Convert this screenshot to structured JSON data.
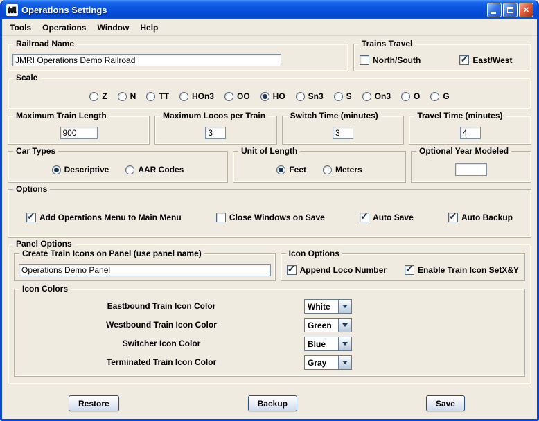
{
  "window": {
    "title": "Operations Settings",
    "controls": {
      "minimize": "minimize",
      "maximize": "maximize",
      "close": "close"
    }
  },
  "colors": {
    "titlebar_blue": "#0a55e0",
    "panel_bg": "#f0ebe0",
    "close_red": "#c23a1a"
  },
  "menu": {
    "items": [
      "Tools",
      "Operations",
      "Window",
      "Help"
    ]
  },
  "railroad": {
    "title": "Railroad Name",
    "value": "JMRI Operations Demo Railroad"
  },
  "trains_travel": {
    "title": "Trains Travel",
    "options": [
      {
        "label": "North/South",
        "checked": false
      },
      {
        "label": "East/West",
        "checked": true
      }
    ]
  },
  "scale": {
    "title": "Scale",
    "options": [
      {
        "label": "Z",
        "selected": false
      },
      {
        "label": "N",
        "selected": false
      },
      {
        "label": "TT",
        "selected": false
      },
      {
        "label": "HOn3",
        "selected": false
      },
      {
        "label": "OO",
        "selected": false
      },
      {
        "label": "HO",
        "selected": true
      },
      {
        "label": "Sn3",
        "selected": false
      },
      {
        "label": "S",
        "selected": false
      },
      {
        "label": "On3",
        "selected": false
      },
      {
        "label": "O",
        "selected": false
      },
      {
        "label": "G",
        "selected": false
      }
    ]
  },
  "limits": {
    "max_train_length": {
      "title": "Maximum Train Length",
      "value": "900"
    },
    "max_locos": {
      "title": "Maximum Locos per Train",
      "value": "3"
    },
    "switch_time": {
      "title": "Switch Time (minutes)",
      "value": "3"
    },
    "travel_time": {
      "title": "Travel Time (minutes)",
      "value": "4"
    }
  },
  "car_types": {
    "title": "Car Types",
    "options": [
      {
        "label": "Descriptive",
        "selected": true
      },
      {
        "label": "AAR Codes",
        "selected": false
      }
    ]
  },
  "unit_of_length": {
    "title": "Unit of Length",
    "options": [
      {
        "label": "Feet",
        "selected": true
      },
      {
        "label": "Meters",
        "selected": false
      }
    ]
  },
  "year_modeled": {
    "title": "Optional Year Modeled",
    "value": ""
  },
  "options": {
    "title": "Options",
    "checkboxes": [
      {
        "label": "Add Operations Menu to Main Menu",
        "checked": true
      },
      {
        "label": "Close Windows on Save",
        "checked": false
      },
      {
        "label": "Auto Save",
        "checked": true
      },
      {
        "label": "Auto Backup",
        "checked": true
      }
    ]
  },
  "panel_options": {
    "title": "Panel Options",
    "create_icons": {
      "title": "Create Train Icons on Panel (use panel name)",
      "value": "Operations Demo Panel"
    },
    "icon_options": {
      "title": "Icon Options",
      "checkboxes": [
        {
          "label": "Append Loco Number",
          "checked": true
        },
        {
          "label": "Enable Train Icon SetX&Y",
          "checked": true
        }
      ]
    },
    "icon_colors": {
      "title": "Icon Colors",
      "rows": [
        {
          "label": "Eastbound Train Icon Color",
          "value": "White"
        },
        {
          "label": "Westbound Train Icon Color",
          "value": "Green"
        },
        {
          "label": "Switcher Icon Color",
          "value": "Blue"
        },
        {
          "label": "Terminated Train Icon Color",
          "value": "Gray"
        }
      ]
    }
  },
  "actions": {
    "restore": "Restore",
    "backup": "Backup",
    "save": "Save"
  }
}
